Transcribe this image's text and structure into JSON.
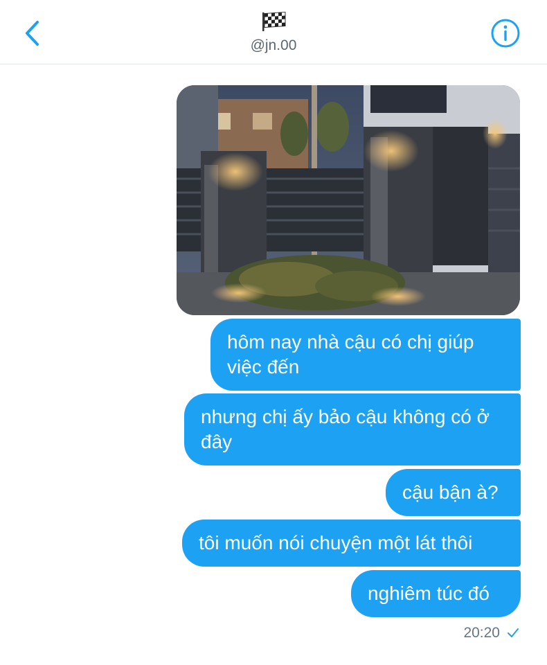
{
  "header": {
    "handle": "@jn.00",
    "avatar_icon": "checkered-flag-icon",
    "back_icon": "chevron-left-icon",
    "info_icon": "info-icon",
    "accent_color": "#1da1f2"
  },
  "conversation": {
    "image": {
      "description_icon": "photo-icon"
    },
    "messages": [
      {
        "text": "hôm nay nhà cậu có chị giúp việc đến"
      },
      {
        "text": "nhưng chị ấy bảo cậu không có ở đây"
      },
      {
        "text": "cậu bận à?"
      },
      {
        "text": "tôi muốn nói chuyện một lát thôi"
      },
      {
        "text": "nghiêm túc đó"
      }
    ],
    "timestamp": "20:20",
    "read_status_icon": "checkmark-icon",
    "bubble_color": "#1da1f2"
  }
}
